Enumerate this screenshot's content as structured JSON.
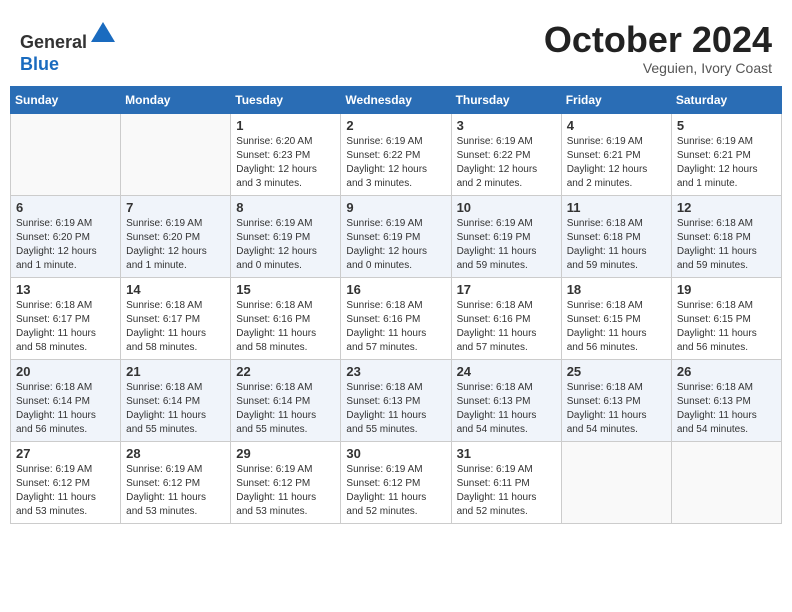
{
  "header": {
    "logo_line1": "General",
    "logo_line2": "Blue",
    "month": "October 2024",
    "location": "Veguien, Ivory Coast"
  },
  "days_of_week": [
    "Sunday",
    "Monday",
    "Tuesday",
    "Wednesday",
    "Thursday",
    "Friday",
    "Saturday"
  ],
  "weeks": [
    [
      {
        "day": "",
        "info": ""
      },
      {
        "day": "",
        "info": ""
      },
      {
        "day": "1",
        "info": "Sunrise: 6:20 AM\nSunset: 6:23 PM\nDaylight: 12 hours and 3 minutes."
      },
      {
        "day": "2",
        "info": "Sunrise: 6:19 AM\nSunset: 6:22 PM\nDaylight: 12 hours and 3 minutes."
      },
      {
        "day": "3",
        "info": "Sunrise: 6:19 AM\nSunset: 6:22 PM\nDaylight: 12 hours and 2 minutes."
      },
      {
        "day": "4",
        "info": "Sunrise: 6:19 AM\nSunset: 6:21 PM\nDaylight: 12 hours and 2 minutes."
      },
      {
        "day": "5",
        "info": "Sunrise: 6:19 AM\nSunset: 6:21 PM\nDaylight: 12 hours and 1 minute."
      }
    ],
    [
      {
        "day": "6",
        "info": "Sunrise: 6:19 AM\nSunset: 6:20 PM\nDaylight: 12 hours and 1 minute."
      },
      {
        "day": "7",
        "info": "Sunrise: 6:19 AM\nSunset: 6:20 PM\nDaylight: 12 hours and 1 minute."
      },
      {
        "day": "8",
        "info": "Sunrise: 6:19 AM\nSunset: 6:19 PM\nDaylight: 12 hours and 0 minutes."
      },
      {
        "day": "9",
        "info": "Sunrise: 6:19 AM\nSunset: 6:19 PM\nDaylight: 12 hours and 0 minutes."
      },
      {
        "day": "10",
        "info": "Sunrise: 6:19 AM\nSunset: 6:19 PM\nDaylight: 11 hours and 59 minutes."
      },
      {
        "day": "11",
        "info": "Sunrise: 6:18 AM\nSunset: 6:18 PM\nDaylight: 11 hours and 59 minutes."
      },
      {
        "day": "12",
        "info": "Sunrise: 6:18 AM\nSunset: 6:18 PM\nDaylight: 11 hours and 59 minutes."
      }
    ],
    [
      {
        "day": "13",
        "info": "Sunrise: 6:18 AM\nSunset: 6:17 PM\nDaylight: 11 hours and 58 minutes."
      },
      {
        "day": "14",
        "info": "Sunrise: 6:18 AM\nSunset: 6:17 PM\nDaylight: 11 hours and 58 minutes."
      },
      {
        "day": "15",
        "info": "Sunrise: 6:18 AM\nSunset: 6:16 PM\nDaylight: 11 hours and 58 minutes."
      },
      {
        "day": "16",
        "info": "Sunrise: 6:18 AM\nSunset: 6:16 PM\nDaylight: 11 hours and 57 minutes."
      },
      {
        "day": "17",
        "info": "Sunrise: 6:18 AM\nSunset: 6:16 PM\nDaylight: 11 hours and 57 minutes."
      },
      {
        "day": "18",
        "info": "Sunrise: 6:18 AM\nSunset: 6:15 PM\nDaylight: 11 hours and 56 minutes."
      },
      {
        "day": "19",
        "info": "Sunrise: 6:18 AM\nSunset: 6:15 PM\nDaylight: 11 hours and 56 minutes."
      }
    ],
    [
      {
        "day": "20",
        "info": "Sunrise: 6:18 AM\nSunset: 6:14 PM\nDaylight: 11 hours and 56 minutes."
      },
      {
        "day": "21",
        "info": "Sunrise: 6:18 AM\nSunset: 6:14 PM\nDaylight: 11 hours and 55 minutes."
      },
      {
        "day": "22",
        "info": "Sunrise: 6:18 AM\nSunset: 6:14 PM\nDaylight: 11 hours and 55 minutes."
      },
      {
        "day": "23",
        "info": "Sunrise: 6:18 AM\nSunset: 6:13 PM\nDaylight: 11 hours and 55 minutes."
      },
      {
        "day": "24",
        "info": "Sunrise: 6:18 AM\nSunset: 6:13 PM\nDaylight: 11 hours and 54 minutes."
      },
      {
        "day": "25",
        "info": "Sunrise: 6:18 AM\nSunset: 6:13 PM\nDaylight: 11 hours and 54 minutes."
      },
      {
        "day": "26",
        "info": "Sunrise: 6:18 AM\nSunset: 6:13 PM\nDaylight: 11 hours and 54 minutes."
      }
    ],
    [
      {
        "day": "27",
        "info": "Sunrise: 6:19 AM\nSunset: 6:12 PM\nDaylight: 11 hours and 53 minutes."
      },
      {
        "day": "28",
        "info": "Sunrise: 6:19 AM\nSunset: 6:12 PM\nDaylight: 11 hours and 53 minutes."
      },
      {
        "day": "29",
        "info": "Sunrise: 6:19 AM\nSunset: 6:12 PM\nDaylight: 11 hours and 53 minutes."
      },
      {
        "day": "30",
        "info": "Sunrise: 6:19 AM\nSunset: 6:12 PM\nDaylight: 11 hours and 52 minutes."
      },
      {
        "day": "31",
        "info": "Sunrise: 6:19 AM\nSunset: 6:11 PM\nDaylight: 11 hours and 52 minutes."
      },
      {
        "day": "",
        "info": ""
      },
      {
        "day": "",
        "info": ""
      }
    ]
  ]
}
